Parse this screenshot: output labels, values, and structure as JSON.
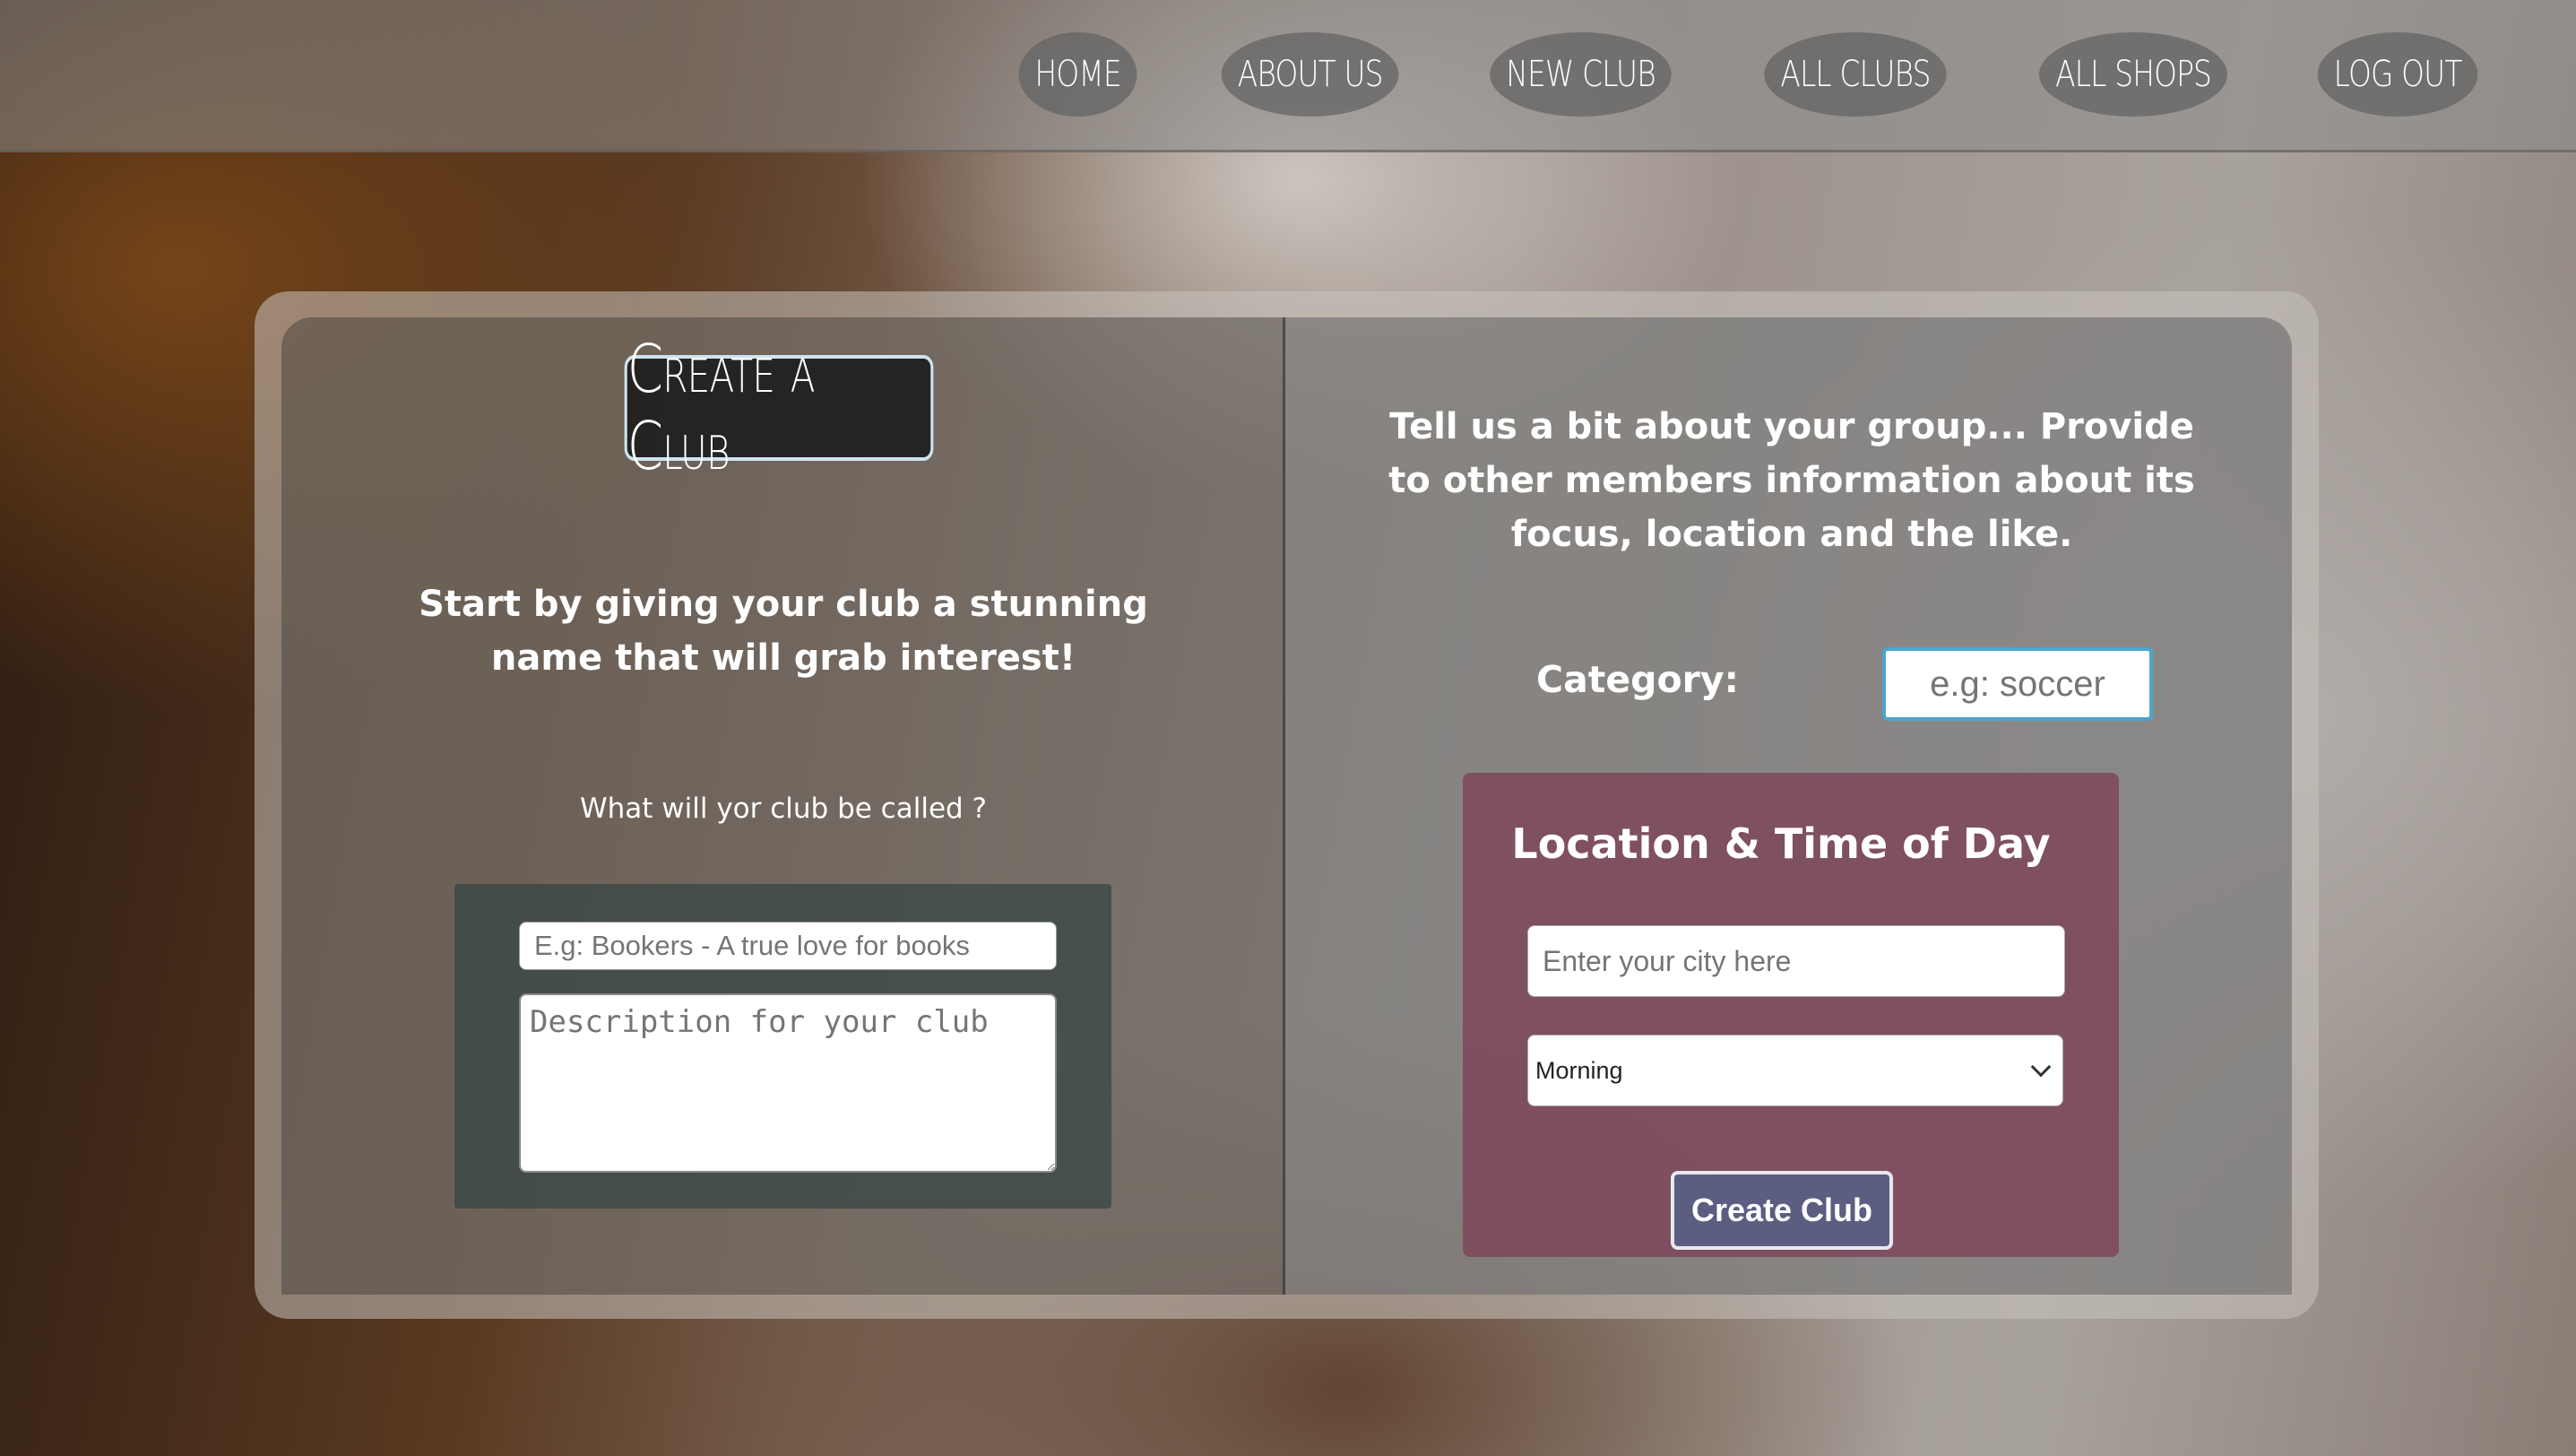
{
  "nav": {
    "items": [
      "Home",
      "About Us",
      "New Club",
      "All Clubs",
      "All Shops",
      "Log Out"
    ]
  },
  "left": {
    "title": "Create a Club",
    "intro": "Start by giving your club a stunning name that will grab interest!",
    "question": "What will yor club be called ?",
    "name_placeholder": "E.g: Bookers - A true love for books",
    "description_placeholder": "Description for your club"
  },
  "right": {
    "intro": "Tell us a bit about your group... Provide to other members information about its focus, location and the like.",
    "category_label": "Category:",
    "category_placeholder": "e.g: soccer",
    "location": {
      "title": "Location & Time of Day",
      "city_placeholder": "Enter your city here",
      "time_selected": "Morning",
      "submit_label": "Create Club"
    }
  },
  "colors": {
    "location_box": "#7d465a",
    "submit_button": "#5b5e80",
    "category_border": "#4aa6cf"
  }
}
